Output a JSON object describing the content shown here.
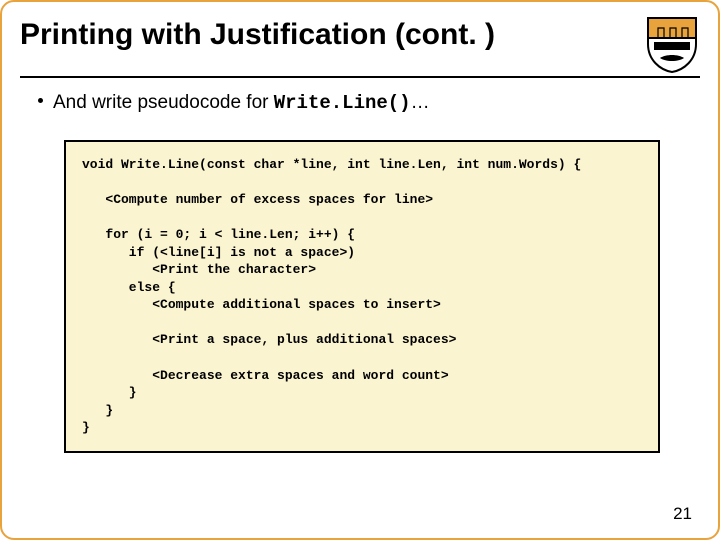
{
  "title": "Printing with Justification (cont. )",
  "bullet": {
    "prefix": "And write pseudocode for ",
    "code": "Write.Line()",
    "suffix": "…"
  },
  "code": "void Write.Line(const char *line, int line.Len, int num.Words) {\n\n   <Compute number of excess spaces for line>\n\n   for (i = 0; i < line.Len; i++) {\n      if (<line[i] is not a space>)\n         <Print the character>\n      else {\n         <Compute additional spaces to insert>\n\n         <Print a space, plus additional spaces>\n\n         <Decrease extra spaces and word count>\n      }\n   }\n}",
  "page_number": "21"
}
